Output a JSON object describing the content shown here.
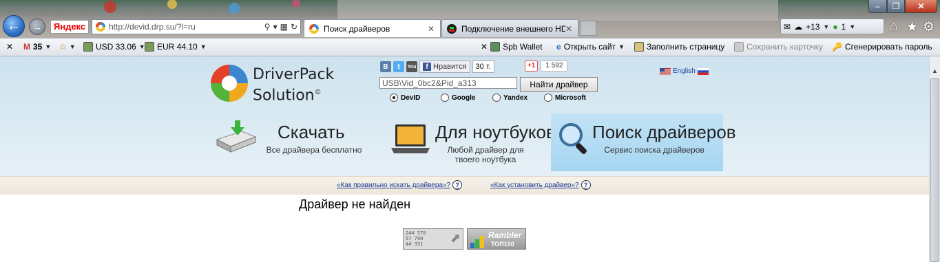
{
  "browser": {
    "window_controls": {
      "minimize": "‒",
      "maximize": "❐",
      "close": "✕"
    },
    "yandex_label": "Яндекс",
    "address_url": "http://devid.drp.su/?l=ru",
    "tabs": [
      {
        "title": "Поиск драйверов",
        "close": "✕"
      },
      {
        "title": "Подключение внешнего HD...",
        "close": "✕"
      }
    ],
    "widgets": {
      "weather": "+13",
      "counter": "1"
    }
  },
  "toolbar": {
    "close": "✕",
    "mail_count": "35",
    "usd": "USD 33.06",
    "eur": "EUR 44.10",
    "spb_wallet": "Spb Wallet",
    "open_site": "Открыть сайт",
    "fill_page": "Заполнить страницу",
    "save_card": "Сохранить карточку",
    "generate_password": "Сгенерировать пароль"
  },
  "site": {
    "logo": {
      "line1": "DriverPack",
      "line2": "Solution"
    },
    "social": {
      "vk": "B",
      "tw": "t",
      "yt": "You",
      "fb_like": "Нравится",
      "fb_count": "30 т.",
      "gplus": "+1",
      "gplus_count": "1 592"
    },
    "lang_label": "English",
    "search": {
      "value": "USB\\Vid_0bc2&Pid_a313",
      "button": "Найти драйвер"
    },
    "engines": [
      {
        "label": "DevID",
        "checked": true
      },
      {
        "label": "Google",
        "checked": false
      },
      {
        "label": "Yandex",
        "checked": false
      },
      {
        "label": "Microsoft",
        "checked": false
      }
    ],
    "menu": [
      {
        "title": "Скачать",
        "sub": "Все драйвера бесплатно"
      },
      {
        "title": "Для ноутбуков",
        "sub": "Любой драйвер для твоего ноутбука"
      },
      {
        "title": "Поиск драйверов",
        "sub": "Сервис поиска драйверов"
      }
    ],
    "help_links": [
      "«Как правильно искать драйвера»?",
      "«Как установить драйвер»?"
    ],
    "help_icon": "?",
    "result": "Драйвер не найден",
    "counter": {
      "lines": "244 578\n57 790\n44 331"
    },
    "rambler": {
      "title": "Rambler",
      "sub": "ТОП100"
    }
  },
  "colors": {
    "accent_blue": "#a6d6f1",
    "link": "#1a3d9a"
  }
}
